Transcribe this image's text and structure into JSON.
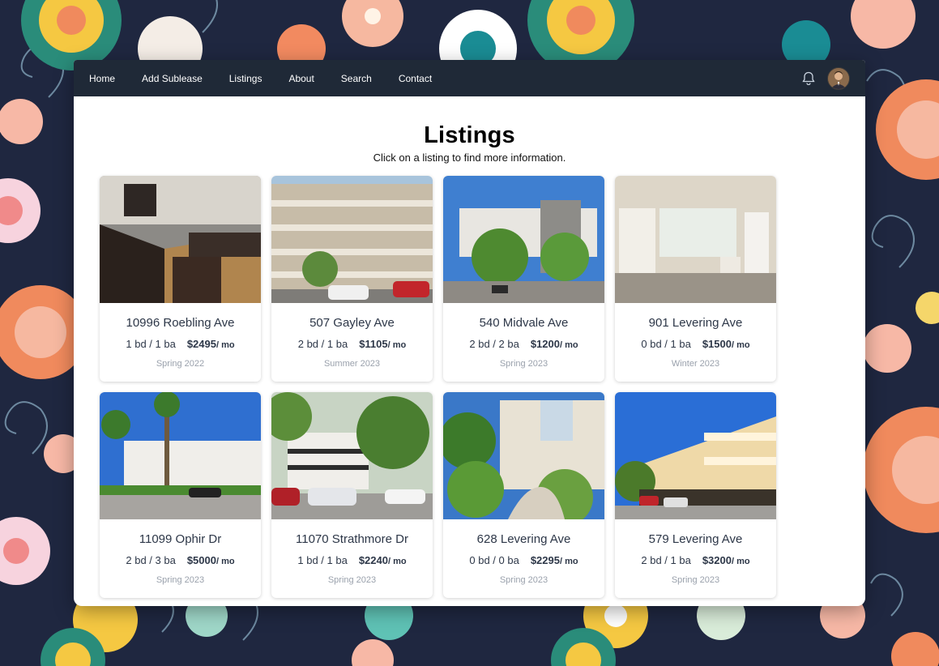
{
  "nav": {
    "items": [
      {
        "label": "Home"
      },
      {
        "label": "Add Sublease"
      },
      {
        "label": "Listings"
      },
      {
        "label": "About"
      },
      {
        "label": "Search"
      },
      {
        "label": "Contact"
      }
    ],
    "notification_icon": "bell-icon",
    "avatar": "user-avatar"
  },
  "page": {
    "title": "Listings",
    "subtitle": "Click on a listing to find more information."
  },
  "listings": [
    {
      "address": "10996 Roebling Ave",
      "rooms": "1 bd / 1 ba",
      "price": "$2495",
      "unit": "/ mo",
      "term": "Spring 2022"
    },
    {
      "address": "507 Gayley Ave",
      "rooms": "2 bd / 1 ba",
      "price": "$1105",
      "unit": "/ mo",
      "term": "Summer 2023"
    },
    {
      "address": "540 Midvale Ave",
      "rooms": "2 bd / 2 ba",
      "price": "$1200",
      "unit": "/ mo",
      "term": "Spring 2023"
    },
    {
      "address": "901 Levering Ave",
      "rooms": "0 bd / 1 ba",
      "price": "$1500",
      "unit": "/ mo",
      "term": "Winter 2023"
    },
    {
      "address": "11099 Ophir Dr",
      "rooms": "2 bd / 3 ba",
      "price": "$5000",
      "unit": "/ mo",
      "term": "Spring 2023"
    },
    {
      "address": "11070 Strathmore Dr",
      "rooms": "1 bd / 1 ba",
      "price": "$2240",
      "unit": "/ mo",
      "term": "Spring 2023"
    },
    {
      "address": "628 Levering Ave",
      "rooms": "0 bd / 0 ba",
      "price": "$2295",
      "unit": "/ mo",
      "term": "Spring 2023"
    },
    {
      "address": "579 Levering Ave",
      "rooms": "2 bd / 1 ba",
      "price": "$3200",
      "unit": "/ mo",
      "term": "Spring 2023"
    }
  ],
  "colors": {
    "navbar": "#1f2937",
    "page_background": "#1f2740",
    "muted_text": "#9aa1ac"
  }
}
